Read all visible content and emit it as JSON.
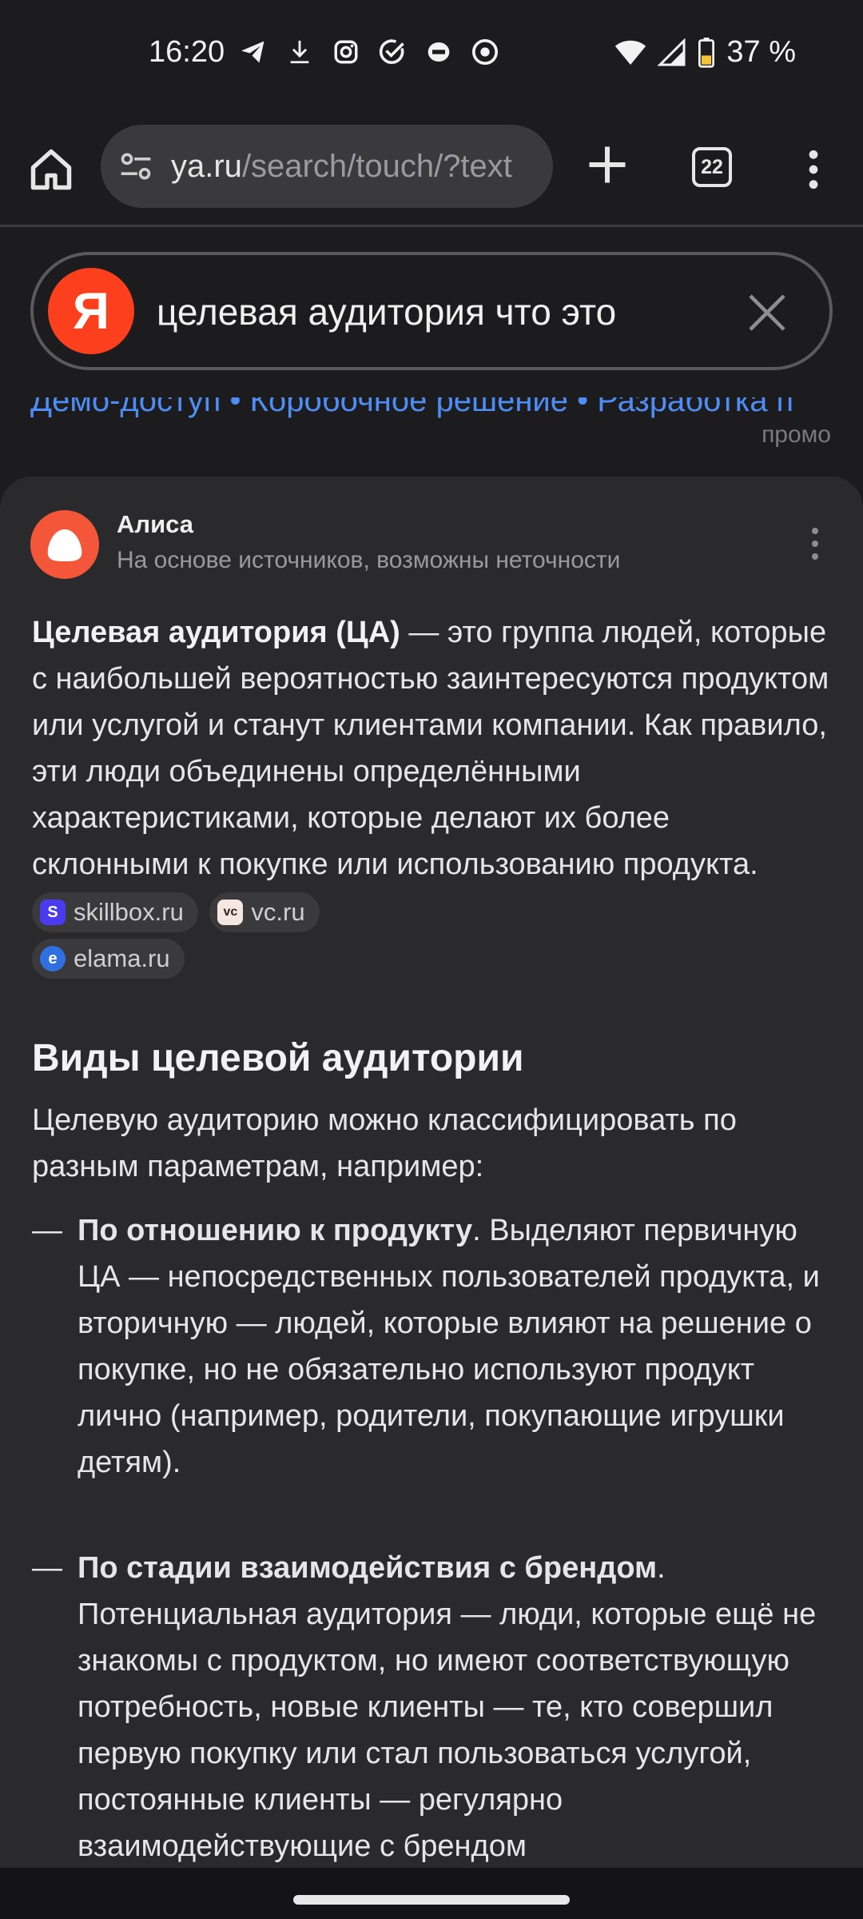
{
  "status_bar": {
    "time": "16:20",
    "notification_icons": [
      "telegram-icon",
      "download-icon",
      "instagram-icon",
      "check-circle-icon",
      "messenger-icon",
      "chrome-icon"
    ],
    "battery": "37 %"
  },
  "browser": {
    "url": "ya.ru/search/touch/?text",
    "url_host": "ya.ru",
    "url_path": "/search/touch/?text",
    "tab_count": "22"
  },
  "search": {
    "logo": "Я",
    "query": "целевая аудитория что это"
  },
  "promo": {
    "links": "Демо-доступ  •  Коробочное решение  •  Разработка п",
    "label": "промо"
  },
  "alisa": {
    "name": "Алиса",
    "subtitle": "На основе источников, возможны неточности"
  },
  "answer": {
    "term": "Целевая аудитория (ЦА)",
    "definition": " — это группа людей, которые с наибольшей вероятностью заинтересуются продуктом или услугой и станут клиентами компании. Как правило, эти люди объединены определёнными характеристиками, которые делают их более склонными к покупке или использованию продукта. ",
    "sources": [
      {
        "icon": "S",
        "label": "skillbox.ru",
        "color": "#4a3af0"
      },
      {
        "icon": "vc",
        "label": "vc.ru",
        "color": "#f4e6e0"
      },
      {
        "icon": "e",
        "label": "elama.ru",
        "color": "#2f6fe0"
      }
    ]
  },
  "section": {
    "title": "Виды целевой аудитории",
    "intro": "Целевую аудиторию можно классифицировать по разным параметрам, например:",
    "items": [
      {
        "dash": "—",
        "heading": "По отношению к продукту",
        "text": ". Выделяют первичную ЦА — непосредственных пользователей продукта, и вторичную — людей, которые влияют на решение о покупке, но не обязательно используют продукт лично (например, родители, покупающие игрушки детям)."
      },
      {
        "dash": "—",
        "heading": "По стадии взаимодействия с брендом",
        "text": ". Потенциальная аудитория — люди, которые ещё не знакомы с продуктом, но имеют соответствующую потребность, новые клиенты — те, кто совершил первую покупку или стал пользоваться услугой, постоянные клиенты — регулярно взаимодействующие с брендом"
      }
    ]
  }
}
